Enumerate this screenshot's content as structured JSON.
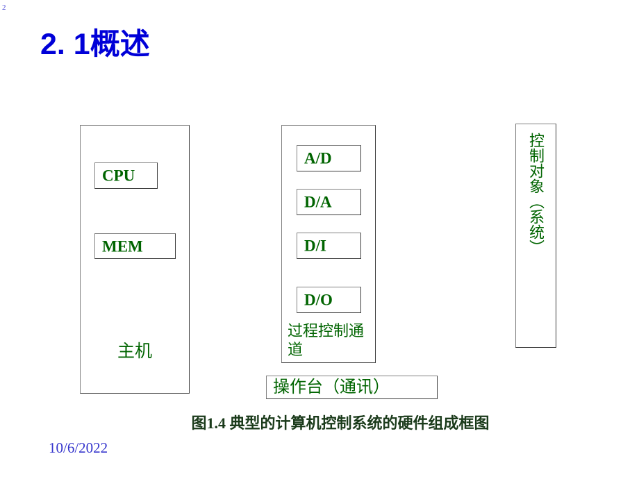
{
  "slide": {
    "page_number": "2",
    "title": "2. 1概述",
    "title_color": "#0000d8",
    "background_color": "#ffffff",
    "footer_date": "10/6/2022",
    "footer_date_color": "#3333cc"
  },
  "diagram": {
    "accent_color": "#006400",
    "border_color": "#808080",
    "host": {
      "label": "主机",
      "components": [
        {
          "name": "cpu",
          "label": "CPU"
        },
        {
          "name": "mem",
          "label": "MEM"
        }
      ]
    },
    "channel": {
      "label": "过程控制通道",
      "components": [
        {
          "name": "ad",
          "label": "A/D"
        },
        {
          "name": "da",
          "label": "D/A"
        },
        {
          "name": "di",
          "label": "D/I"
        },
        {
          "name": "do",
          "label": "D/O"
        }
      ]
    },
    "controlled_object": {
      "label": "控制对象（系统）",
      "orientation": "vertical"
    },
    "console": {
      "label": "操作台（通讯）"
    },
    "caption": "图1.4 典型的计算机控制系统的硬件组成框图"
  }
}
